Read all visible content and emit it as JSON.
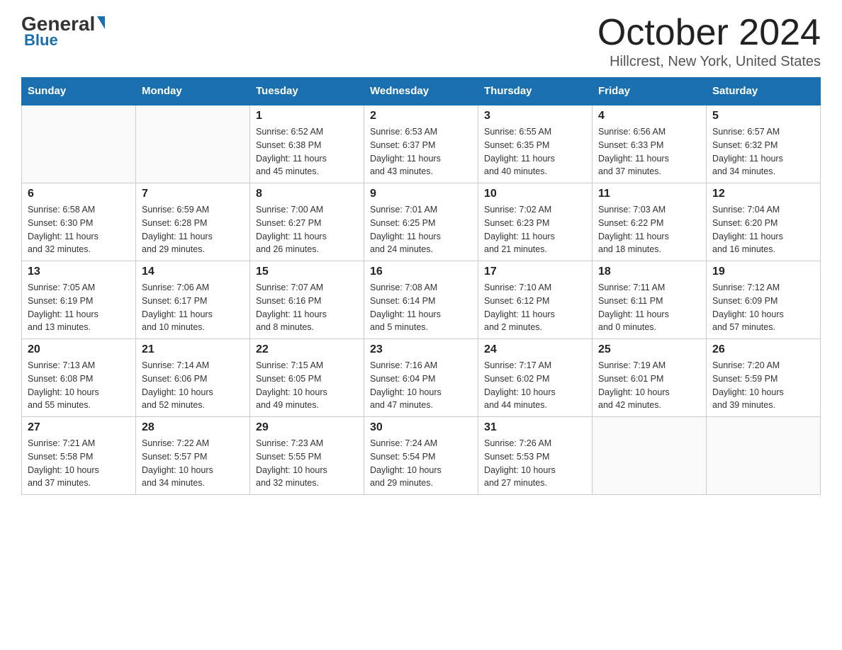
{
  "header": {
    "logo_general": "General",
    "logo_blue": "Blue",
    "month_title": "October 2024",
    "location": "Hillcrest, New York, United States"
  },
  "weekdays": [
    "Sunday",
    "Monday",
    "Tuesday",
    "Wednesday",
    "Thursday",
    "Friday",
    "Saturday"
  ],
  "weeks": [
    [
      {
        "day": "",
        "info": ""
      },
      {
        "day": "",
        "info": ""
      },
      {
        "day": "1",
        "info": "Sunrise: 6:52 AM\nSunset: 6:38 PM\nDaylight: 11 hours\nand 45 minutes."
      },
      {
        "day": "2",
        "info": "Sunrise: 6:53 AM\nSunset: 6:37 PM\nDaylight: 11 hours\nand 43 minutes."
      },
      {
        "day": "3",
        "info": "Sunrise: 6:55 AM\nSunset: 6:35 PM\nDaylight: 11 hours\nand 40 minutes."
      },
      {
        "day": "4",
        "info": "Sunrise: 6:56 AM\nSunset: 6:33 PM\nDaylight: 11 hours\nand 37 minutes."
      },
      {
        "day": "5",
        "info": "Sunrise: 6:57 AM\nSunset: 6:32 PM\nDaylight: 11 hours\nand 34 minutes."
      }
    ],
    [
      {
        "day": "6",
        "info": "Sunrise: 6:58 AM\nSunset: 6:30 PM\nDaylight: 11 hours\nand 32 minutes."
      },
      {
        "day": "7",
        "info": "Sunrise: 6:59 AM\nSunset: 6:28 PM\nDaylight: 11 hours\nand 29 minutes."
      },
      {
        "day": "8",
        "info": "Sunrise: 7:00 AM\nSunset: 6:27 PM\nDaylight: 11 hours\nand 26 minutes."
      },
      {
        "day": "9",
        "info": "Sunrise: 7:01 AM\nSunset: 6:25 PM\nDaylight: 11 hours\nand 24 minutes."
      },
      {
        "day": "10",
        "info": "Sunrise: 7:02 AM\nSunset: 6:23 PM\nDaylight: 11 hours\nand 21 minutes."
      },
      {
        "day": "11",
        "info": "Sunrise: 7:03 AM\nSunset: 6:22 PM\nDaylight: 11 hours\nand 18 minutes."
      },
      {
        "day": "12",
        "info": "Sunrise: 7:04 AM\nSunset: 6:20 PM\nDaylight: 11 hours\nand 16 minutes."
      }
    ],
    [
      {
        "day": "13",
        "info": "Sunrise: 7:05 AM\nSunset: 6:19 PM\nDaylight: 11 hours\nand 13 minutes."
      },
      {
        "day": "14",
        "info": "Sunrise: 7:06 AM\nSunset: 6:17 PM\nDaylight: 11 hours\nand 10 minutes."
      },
      {
        "day": "15",
        "info": "Sunrise: 7:07 AM\nSunset: 6:16 PM\nDaylight: 11 hours\nand 8 minutes."
      },
      {
        "day": "16",
        "info": "Sunrise: 7:08 AM\nSunset: 6:14 PM\nDaylight: 11 hours\nand 5 minutes."
      },
      {
        "day": "17",
        "info": "Sunrise: 7:10 AM\nSunset: 6:12 PM\nDaylight: 11 hours\nand 2 minutes."
      },
      {
        "day": "18",
        "info": "Sunrise: 7:11 AM\nSunset: 6:11 PM\nDaylight: 11 hours\nand 0 minutes."
      },
      {
        "day": "19",
        "info": "Sunrise: 7:12 AM\nSunset: 6:09 PM\nDaylight: 10 hours\nand 57 minutes."
      }
    ],
    [
      {
        "day": "20",
        "info": "Sunrise: 7:13 AM\nSunset: 6:08 PM\nDaylight: 10 hours\nand 55 minutes."
      },
      {
        "day": "21",
        "info": "Sunrise: 7:14 AM\nSunset: 6:06 PM\nDaylight: 10 hours\nand 52 minutes."
      },
      {
        "day": "22",
        "info": "Sunrise: 7:15 AM\nSunset: 6:05 PM\nDaylight: 10 hours\nand 49 minutes."
      },
      {
        "day": "23",
        "info": "Sunrise: 7:16 AM\nSunset: 6:04 PM\nDaylight: 10 hours\nand 47 minutes."
      },
      {
        "day": "24",
        "info": "Sunrise: 7:17 AM\nSunset: 6:02 PM\nDaylight: 10 hours\nand 44 minutes."
      },
      {
        "day": "25",
        "info": "Sunrise: 7:19 AM\nSunset: 6:01 PM\nDaylight: 10 hours\nand 42 minutes."
      },
      {
        "day": "26",
        "info": "Sunrise: 7:20 AM\nSunset: 5:59 PM\nDaylight: 10 hours\nand 39 minutes."
      }
    ],
    [
      {
        "day": "27",
        "info": "Sunrise: 7:21 AM\nSunset: 5:58 PM\nDaylight: 10 hours\nand 37 minutes."
      },
      {
        "day": "28",
        "info": "Sunrise: 7:22 AM\nSunset: 5:57 PM\nDaylight: 10 hours\nand 34 minutes."
      },
      {
        "day": "29",
        "info": "Sunrise: 7:23 AM\nSunset: 5:55 PM\nDaylight: 10 hours\nand 32 minutes."
      },
      {
        "day": "30",
        "info": "Sunrise: 7:24 AM\nSunset: 5:54 PM\nDaylight: 10 hours\nand 29 minutes."
      },
      {
        "day": "31",
        "info": "Sunrise: 7:26 AM\nSunset: 5:53 PM\nDaylight: 10 hours\nand 27 minutes."
      },
      {
        "day": "",
        "info": ""
      },
      {
        "day": "",
        "info": ""
      }
    ]
  ]
}
